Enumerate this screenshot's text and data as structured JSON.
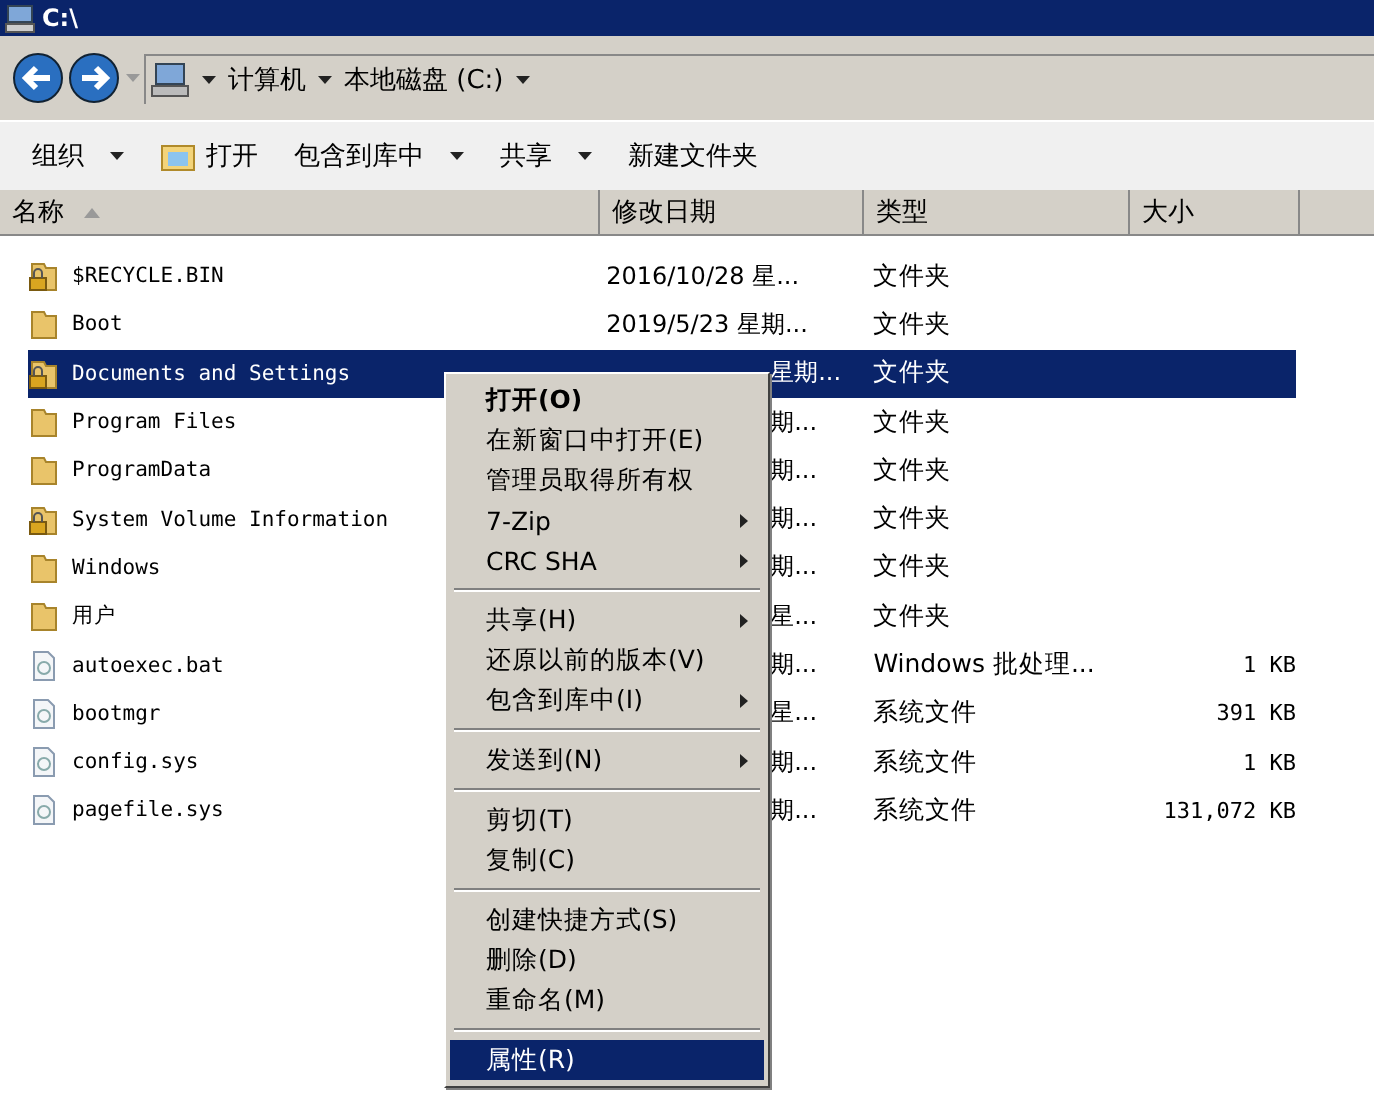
{
  "window": {
    "title": "C:\\"
  },
  "address": {
    "segments": [
      "计算机",
      "本地磁盘 (C:)"
    ]
  },
  "toolbar": [
    {
      "label": "组织",
      "dropdown": true,
      "icon": false
    },
    {
      "label": "打开",
      "dropdown": false,
      "icon": true
    },
    {
      "label": "包含到库中",
      "dropdown": true,
      "icon": false
    },
    {
      "label": "共享",
      "dropdown": true,
      "icon": false
    },
    {
      "label": "新建文件夹",
      "dropdown": false,
      "icon": false
    }
  ],
  "columns": [
    {
      "label": "名称",
      "sorted": true
    },
    {
      "label": "修改日期",
      "sorted": false
    },
    {
      "label": "类型",
      "sorted": false
    },
    {
      "label": "大小",
      "sorted": false
    }
  ],
  "rows": [
    {
      "kind": "locked-folder",
      "name": "$RECYCLE.BIN",
      "date": "2016/10/28 星...",
      "date_covered": false,
      "type": "文件夹",
      "size": "",
      "selected": false
    },
    {
      "kind": "folder",
      "name": "Boot",
      "date": "2019/5/23 星期...",
      "date_covered": false,
      "type": "文件夹",
      "size": "",
      "selected": false
    },
    {
      "kind": "locked-folder",
      "name": "Documents and Settings",
      "date": "星期...",
      "date_covered": true,
      "type": "文件夹",
      "size": "",
      "selected": true
    },
    {
      "kind": "folder",
      "name": "Program Files",
      "date": "期...",
      "date_covered": true,
      "type": "文件夹",
      "size": "",
      "selected": false
    },
    {
      "kind": "folder",
      "name": "ProgramData",
      "date": "期...",
      "date_covered": true,
      "type": "文件夹",
      "size": "",
      "selected": false
    },
    {
      "kind": "locked-folder",
      "name": "System Volume Information",
      "date": "期...",
      "date_covered": true,
      "type": "文件夹",
      "size": "",
      "selected": false
    },
    {
      "kind": "folder",
      "name": "Windows",
      "date": "期...",
      "date_covered": true,
      "type": "文件夹",
      "size": "",
      "selected": false
    },
    {
      "kind": "folder",
      "name": "用户",
      "date": "星...",
      "date_covered": true,
      "type": "文件夹",
      "size": "",
      "selected": false
    },
    {
      "kind": "file",
      "name": "autoexec.bat",
      "date": "期...",
      "date_covered": true,
      "type": "Windows 批处理...",
      "size": "1 KB",
      "selected": false
    },
    {
      "kind": "file",
      "name": "bootmgr",
      "date": "星...",
      "date_covered": true,
      "type": "系统文件",
      "size": "391 KB",
      "selected": false
    },
    {
      "kind": "file",
      "name": "config.sys",
      "date": "期...",
      "date_covered": true,
      "type": "系统文件",
      "size": "1 KB",
      "selected": false
    },
    {
      "kind": "file",
      "name": "pagefile.sys",
      "date": "期...",
      "date_covered": true,
      "type": "系统文件",
      "size": "131,072 KB",
      "selected": false
    }
  ],
  "context_menu": [
    {
      "kind": "item",
      "label": "打开(O)",
      "bold": true,
      "submenu": false,
      "selected": false
    },
    {
      "kind": "item",
      "label": "在新窗口中打开(E)",
      "bold": false,
      "submenu": false,
      "selected": false
    },
    {
      "kind": "item",
      "label": "管理员取得所有权",
      "bold": false,
      "submenu": false,
      "selected": false
    },
    {
      "kind": "item",
      "label": "7-Zip",
      "bold": false,
      "submenu": true,
      "selected": false
    },
    {
      "kind": "item",
      "label": "CRC SHA",
      "bold": false,
      "submenu": true,
      "selected": false
    },
    {
      "kind": "separator"
    },
    {
      "kind": "item",
      "label": "共享(H)",
      "bold": false,
      "submenu": true,
      "selected": false
    },
    {
      "kind": "item",
      "label": "还原以前的版本(V)",
      "bold": false,
      "submenu": false,
      "selected": false
    },
    {
      "kind": "item",
      "label": "包含到库中(I)",
      "bold": false,
      "submenu": true,
      "selected": false
    },
    {
      "kind": "separator"
    },
    {
      "kind": "item",
      "label": "发送到(N)",
      "bold": false,
      "submenu": true,
      "selected": false
    },
    {
      "kind": "separator"
    },
    {
      "kind": "item",
      "label": "剪切(T)",
      "bold": false,
      "submenu": false,
      "selected": false
    },
    {
      "kind": "item",
      "label": "复制(C)",
      "bold": false,
      "submenu": false,
      "selected": false
    },
    {
      "kind": "separator"
    },
    {
      "kind": "item",
      "label": "创建快捷方式(S)",
      "bold": false,
      "submenu": false,
      "selected": false
    },
    {
      "kind": "item",
      "label": "删除(D)",
      "bold": false,
      "submenu": false,
      "selected": false
    },
    {
      "kind": "item",
      "label": "重命名(M)",
      "bold": false,
      "submenu": false,
      "selected": false
    },
    {
      "kind": "separator"
    },
    {
      "kind": "item",
      "label": "属性(R)",
      "bold": false,
      "submenu": false,
      "selected": true
    }
  ]
}
